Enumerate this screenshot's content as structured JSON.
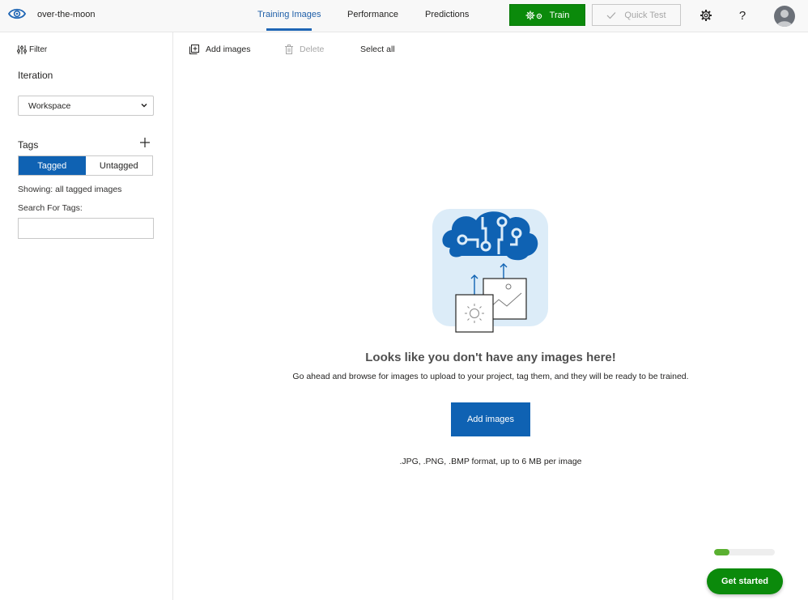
{
  "header": {
    "project_name": "over-the-moon",
    "tabs": [
      {
        "label": "Training Images",
        "active": true
      },
      {
        "label": "Performance",
        "active": false
      },
      {
        "label": "Predictions",
        "active": false
      }
    ],
    "train_label": "Train",
    "quick_test_label": "Quick Test",
    "help_label": "?",
    "icons": {
      "logo": "eye-icon",
      "train": "gears-icon",
      "quick_test": "checkmark-icon",
      "settings": "gear-icon",
      "help": "question-icon",
      "avatar": "user-avatar-icon"
    }
  },
  "sidebar": {
    "filter_label": "Filter",
    "iteration_label": "Iteration",
    "iteration_selected": "Workspace",
    "tags_label": "Tags",
    "tag_toggle": [
      {
        "label": "Tagged",
        "active": true
      },
      {
        "label": "Untagged",
        "active": false
      }
    ],
    "showing_text": "Showing: all tagged images",
    "search_label": "Search For Tags:",
    "search_value": "",
    "search_placeholder": ""
  },
  "toolbar": {
    "add_images_label": "Add images",
    "delete_label": "Delete",
    "select_all_label": "Select all"
  },
  "empty_state": {
    "title": "Looks like you don't have any images here!",
    "subtitle": "Go ahead and browse for images to upload to your project, tag them, and they will be ready to be trained.",
    "add_button_label": "Add images",
    "formats_note": ".JPG, .PNG, .BMP format, up to 6 MB per image"
  },
  "onboarding": {
    "progress_percent": 25,
    "button_label": "Get started"
  },
  "colors": {
    "accent_blue": "#0f62b3",
    "train_green": "#0b8a0b",
    "progress_green": "#5ab031"
  }
}
